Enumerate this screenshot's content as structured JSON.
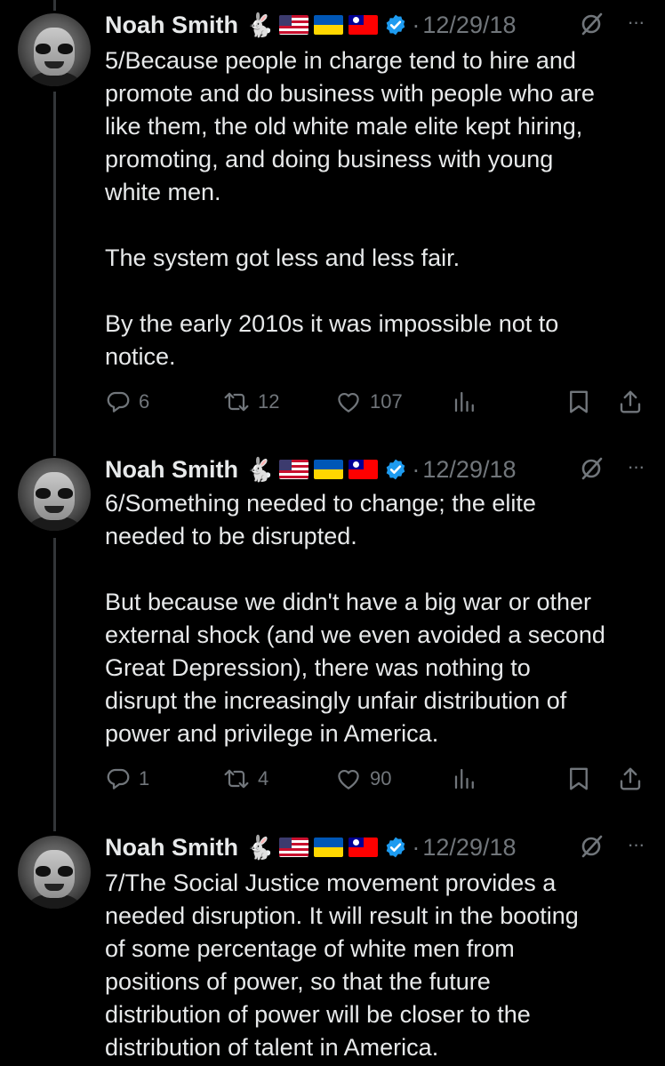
{
  "tweets": [
    {
      "author": "Noah Smith",
      "rabbit": "🐇",
      "separator": "·",
      "date": "12/29/18",
      "more": "···",
      "text": "5/Because people in charge tend to hire and\npromote and do business with people who are\nlike them, the old white male elite kept hiring,\npromoting, and doing business with young\nwhite men.\n\nThe system got less and less fair.\n\nBy the early 2010s it was impossible not to\nnotice.",
      "replies": "6",
      "reposts": "12",
      "likes": "107"
    },
    {
      "author": "Noah Smith",
      "rabbit": "🐇",
      "separator": "·",
      "date": "12/29/18",
      "more": "···",
      "text": "6/Something needed to change; the elite\nneeded to be disrupted.\n\nBut because we didn't have a big war or other\nexternal shock (and we even avoided a second\nGreat Depression), there was nothing to\ndisrupt the increasingly unfair distribution of\npower and privilege in America.",
      "replies": "1",
      "reposts": "4",
      "likes": "90"
    },
    {
      "author": "Noah Smith",
      "rabbit": "🐇",
      "separator": "·",
      "date": "12/29/18",
      "more": "···",
      "text": "7/The Social Justice movement provides a\nneeded disruption. It will result in the booting\nof some percentage of white men from\npositions of power, so that the future\ndistribution of power will be closer to the\ndistribution of talent in America."
    }
  ],
  "icons": {
    "avatar": "avatar-image",
    "rabbit": "rabbit-emoji",
    "flags": [
      "us-flag-icon",
      "ukraine-flag-icon",
      "taiwan-flag-icon"
    ],
    "verified": "verified-badge-icon",
    "grok": "grok-icon",
    "more": "more-icon",
    "reply": "reply-icon",
    "repost": "repost-icon",
    "like": "like-icon",
    "views": "views-icon",
    "bookmark": "bookmark-icon",
    "share": "share-icon"
  },
  "colors": {
    "background": "#000000",
    "text": "#e7e9ea",
    "muted": "#71767b",
    "verified": "#1d9bf0",
    "thread_line": "#333639"
  }
}
